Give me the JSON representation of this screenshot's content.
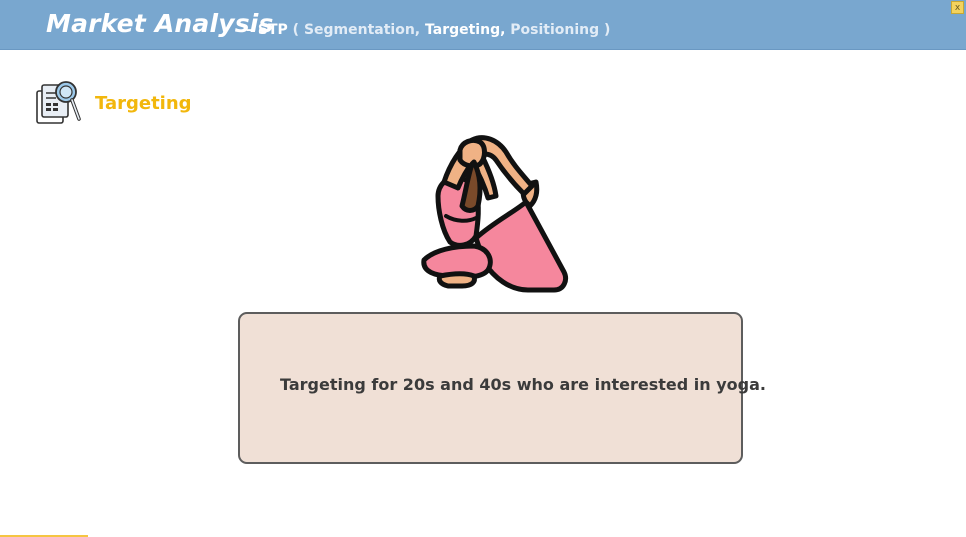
{
  "header": {
    "title": "Market Analysis",
    "dash": "–",
    "stp_label": "STP",
    "paren_open": "(",
    "paren_close": ")",
    "items": [
      "Segmentation,",
      "Targeting,",
      "Positioning"
    ],
    "active_item": "Targeting",
    "close_label": "x",
    "colors": {
      "bar": "#79a7cf",
      "text": "#ffffff",
      "muted": "#e2ecf6"
    }
  },
  "section": {
    "icon": "document-magnifier-icon",
    "title": "Targeting",
    "title_color": "#f2b70c"
  },
  "illustration": {
    "icon": "yoga-pose-icon"
  },
  "card": {
    "text": "Targeting for 20s and 40s who are interested in yoga.",
    "background": "#f0e0d6",
    "border": "#5d5d5d"
  }
}
